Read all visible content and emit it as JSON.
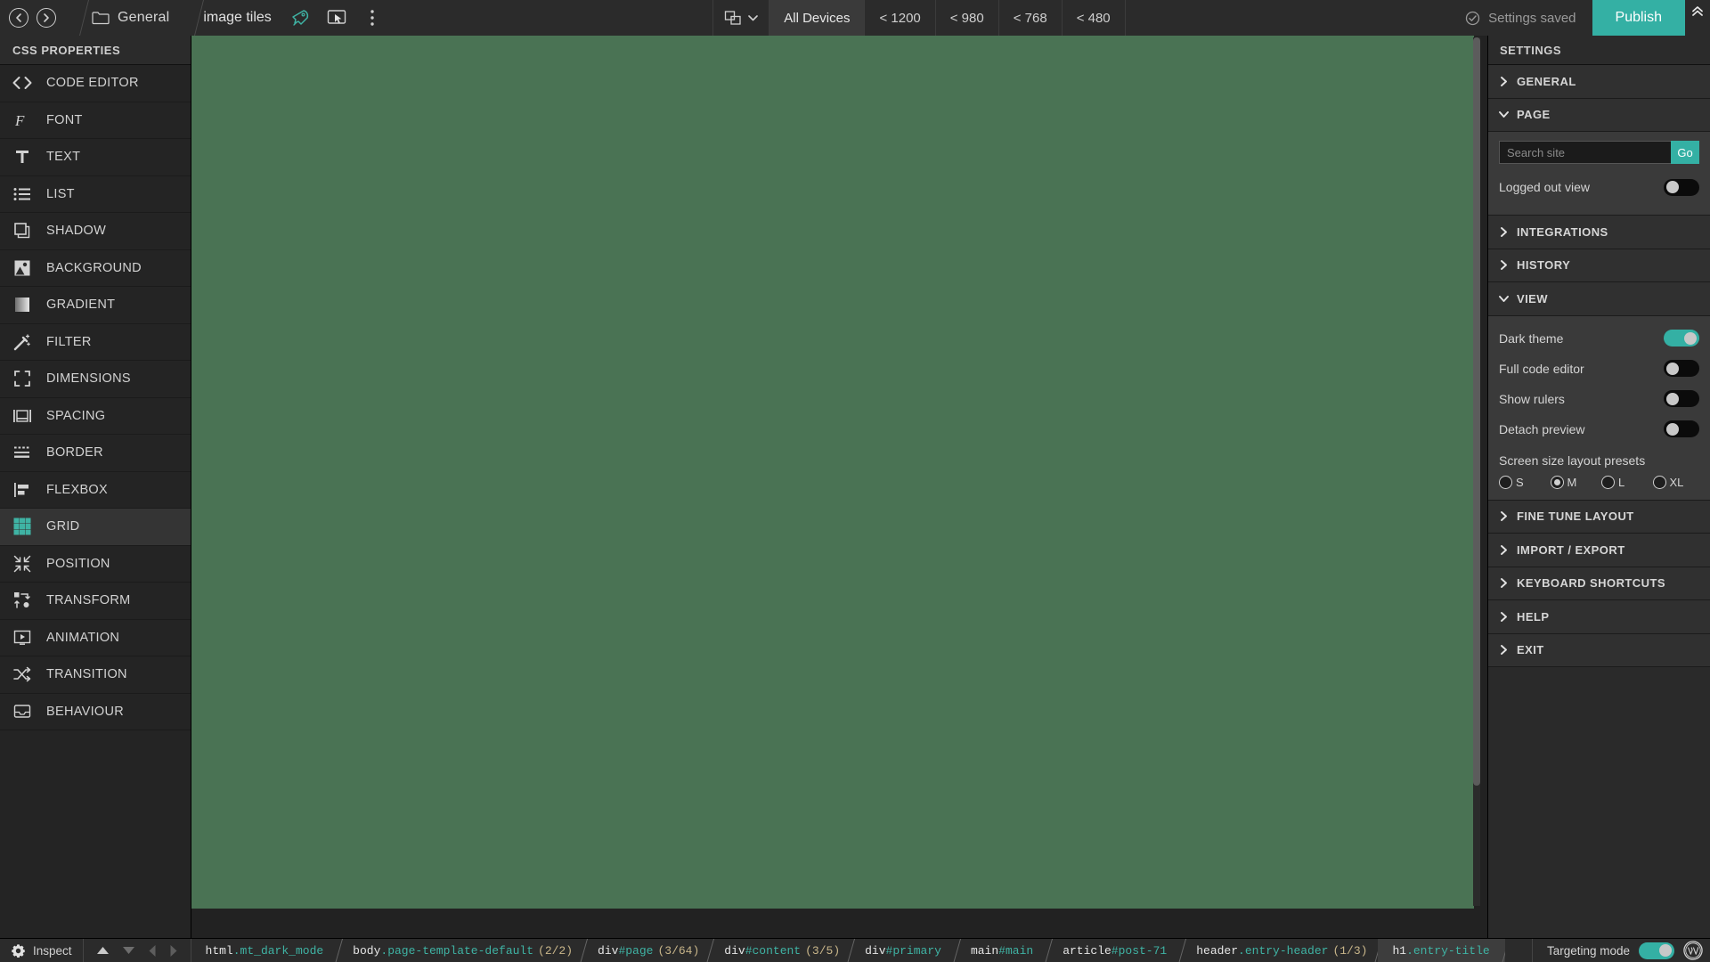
{
  "topbar": {
    "back_icon": "arrow-left-circle-icon",
    "forward_icon": "arrow-right-circle-icon",
    "folder_icon": "folder-icon",
    "folder_label": "General",
    "page_title": "image tiles",
    "rocket_icon": "rocket-icon",
    "preview_icon": "preview-pointer-icon",
    "more_icon": "more-vertical-icon",
    "device_picker_icon": "devices-icon",
    "device_picker_chevron": "chevron-down-icon",
    "devices": [
      {
        "label": "All Devices",
        "active": true
      },
      {
        "label": "< 1200",
        "active": false
      },
      {
        "label": "< 980",
        "active": false
      },
      {
        "label": "< 768",
        "active": false
      },
      {
        "label": "< 480",
        "active": false
      }
    ],
    "saved_icon": "check-circle-icon",
    "saved_label": "Settings saved",
    "publish_label": "Publish",
    "collapse_icon": "chevron-double-up-icon"
  },
  "sidebar": {
    "header": "CSS PROPERTIES",
    "items": [
      {
        "label": "CODE EDITOR",
        "icon": "code-brackets-icon",
        "active": false
      },
      {
        "label": "FONT",
        "icon": "font-f-icon",
        "active": false
      },
      {
        "label": "TEXT",
        "icon": "text-t-icon",
        "active": false
      },
      {
        "label": "LIST",
        "icon": "list-icon",
        "active": false
      },
      {
        "label": "SHADOW",
        "icon": "shadow-squares-icon",
        "active": false
      },
      {
        "label": "BACKGROUND",
        "icon": "image-icon",
        "active": false
      },
      {
        "label": "GRADIENT",
        "icon": "gradient-icon",
        "active": false
      },
      {
        "label": "FILTER",
        "icon": "magic-wand-icon",
        "active": false
      },
      {
        "label": "DIMENSIONS",
        "icon": "crop-corners-icon",
        "active": false
      },
      {
        "label": "SPACING",
        "icon": "spacing-icon",
        "active": false
      },
      {
        "label": "BORDER",
        "icon": "border-lines-icon",
        "active": false
      },
      {
        "label": "FLEXBOX",
        "icon": "flexbox-icon",
        "active": false
      },
      {
        "label": "GRID",
        "icon": "grid-icon",
        "active": true
      },
      {
        "label": "POSITION",
        "icon": "position-arrows-icon",
        "active": false
      },
      {
        "label": "TRANSFORM",
        "icon": "transform-icon",
        "active": false
      },
      {
        "label": "ANIMATION",
        "icon": "play-screen-icon",
        "active": false
      },
      {
        "label": "TRANSITION",
        "icon": "shuffle-icon",
        "active": false
      },
      {
        "label": "BEHAVIOUR",
        "icon": "inbox-icon",
        "active": false
      }
    ]
  },
  "canvas": {
    "background_color": "#4a7354"
  },
  "settings": {
    "header": "SETTINGS",
    "sections": {
      "general": {
        "label": "GENERAL",
        "expanded": false
      },
      "page": {
        "label": "PAGE",
        "expanded": true
      },
      "integrations": {
        "label": "INTEGRATIONS",
        "expanded": false
      },
      "history": {
        "label": "HISTORY",
        "expanded": false
      },
      "view": {
        "label": "VIEW",
        "expanded": true
      },
      "fine_tune_layout": {
        "label": "FINE TUNE LAYOUT",
        "expanded": false
      },
      "import_export": {
        "label": "IMPORT / EXPORT",
        "expanded": false
      },
      "keyboard_shortcuts": {
        "label": "KEYBOARD SHORTCUTS",
        "expanded": false
      },
      "help": {
        "label": "HELP",
        "expanded": false
      },
      "exit": {
        "label": "EXIT",
        "expanded": false
      }
    },
    "page_panel": {
      "search_placeholder": "Search site",
      "search_value": "",
      "go_label": "Go",
      "logged_out_view": {
        "label": "Logged out view",
        "on": false
      }
    },
    "view_panel": {
      "toggles": [
        {
          "label": "Dark theme",
          "on": true
        },
        {
          "label": "Full code editor",
          "on": false
        },
        {
          "label": "Show rulers",
          "on": false
        },
        {
          "label": "Detach preview",
          "on": false
        }
      ],
      "presets_label": "Screen size layout presets",
      "presets": [
        {
          "label": "S",
          "selected": false
        },
        {
          "label": "M",
          "selected": true
        },
        {
          "label": "L",
          "selected": false
        },
        {
          "label": "XL",
          "selected": false
        }
      ]
    },
    "accent_color": "#34b0a4"
  },
  "bottombar": {
    "inspect_icon": "gear-icon",
    "inspect_label": "Inspect",
    "nav": {
      "up_icon": "triangle-up-icon",
      "down_icon": "triangle-down-icon",
      "left_icon": "triangle-left-icon",
      "right_icon": "triangle-right-icon"
    },
    "breadcrumbs": [
      {
        "tag": "html",
        "sel": ".mt_dark_mode",
        "count": "",
        "active": false
      },
      {
        "tag": "body",
        "sel": ".page-template-default",
        "count": "(2/2)",
        "active": false
      },
      {
        "tag": "div",
        "sel": "#page",
        "count": "(3/64)",
        "active": false
      },
      {
        "tag": "div",
        "sel": "#content",
        "count": "(3/5)",
        "active": false
      },
      {
        "tag": "div",
        "sel": "#primary",
        "count": "",
        "active": false
      },
      {
        "tag": "main",
        "sel": "#main",
        "count": "",
        "active": false
      },
      {
        "tag": "article",
        "sel": "#post-71",
        "count": "",
        "active": false
      },
      {
        "tag": "header",
        "sel": ".entry-header",
        "count": "(1/3)",
        "active": false
      },
      {
        "tag": "h1",
        "sel": ".entry-title",
        "count": "",
        "active": true
      }
    ],
    "targeting": {
      "label": "Targeting mode",
      "on": true
    },
    "wp_icon": "wordpress-logo-icon"
  }
}
